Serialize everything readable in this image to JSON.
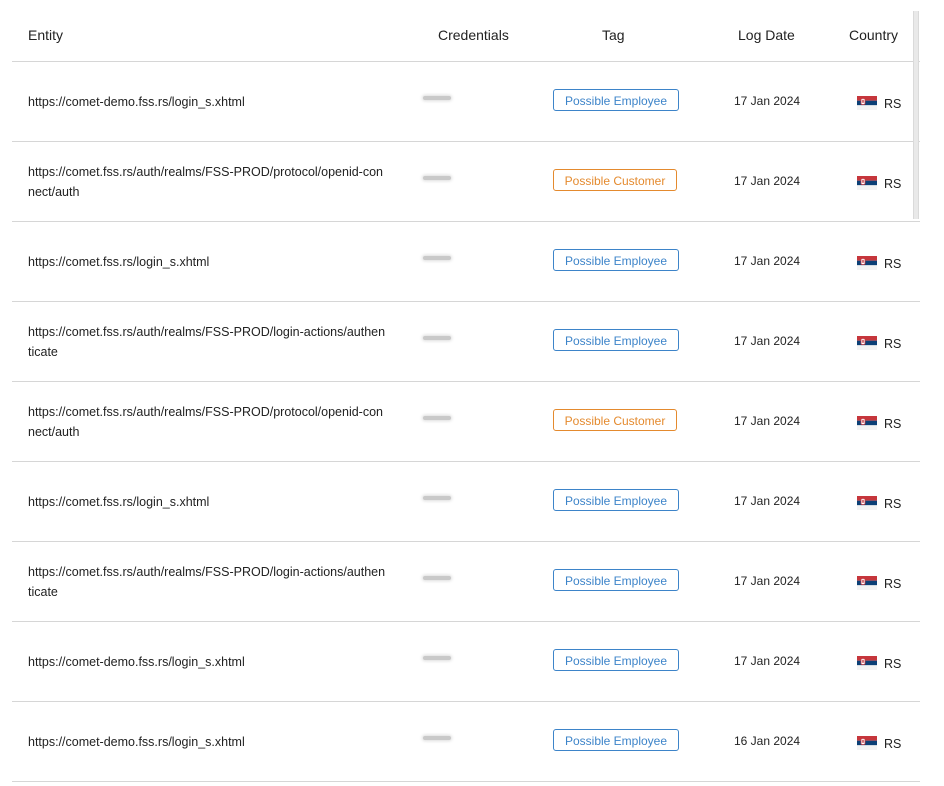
{
  "headers": {
    "entity": "Entity",
    "credentials": "Credentials",
    "tag": "Tag",
    "log_date": "Log Date",
    "country": "Country"
  },
  "tag_colors": {
    "Possible Employee": "#3d84c9",
    "Possible Customer": "#e48a2e"
  },
  "rows": [
    {
      "entity": "https://comet-demo.fss.rs/login_s.xhtml",
      "tag": "Possible Employee",
      "tag_type": "employee",
      "date": "17 Jan 2024",
      "country": "RS",
      "flag_icon": "serbia-flag-icon"
    },
    {
      "entity": "https://comet.fss.rs/auth/realms/FSS-PROD/protocol/openid-connect/auth",
      "tag": "Possible Customer",
      "tag_type": "customer",
      "date": "17 Jan 2024",
      "country": "RS",
      "flag_icon": "serbia-flag-icon"
    },
    {
      "entity": "https://comet.fss.rs/login_s.xhtml",
      "tag": "Possible Employee",
      "tag_type": "employee",
      "date": "17 Jan 2024",
      "country": "RS",
      "flag_icon": "serbia-flag-icon"
    },
    {
      "entity": "https://comet.fss.rs/auth/realms/FSS-PROD/login-actions/authenticate",
      "tag": "Possible Employee",
      "tag_type": "employee",
      "date": "17 Jan 2024",
      "country": "RS",
      "flag_icon": "serbia-flag-icon"
    },
    {
      "entity": "https://comet.fss.rs/auth/realms/FSS-PROD/protocol/openid-connect/auth",
      "tag": "Possible Customer",
      "tag_type": "customer",
      "date": "17 Jan 2024",
      "country": "RS",
      "flag_icon": "serbia-flag-icon"
    },
    {
      "entity": "https://comet.fss.rs/login_s.xhtml",
      "tag": "Possible Employee",
      "tag_type": "employee",
      "date": "17 Jan 2024",
      "country": "RS",
      "flag_icon": "serbia-flag-icon"
    },
    {
      "entity": "https://comet.fss.rs/auth/realms/FSS-PROD/login-actions/authenticate",
      "tag": "Possible Employee",
      "tag_type": "employee",
      "date": "17 Jan 2024",
      "country": "RS",
      "flag_icon": "serbia-flag-icon"
    },
    {
      "entity": "https://comet-demo.fss.rs/login_s.xhtml",
      "tag": "Possible Employee",
      "tag_type": "employee",
      "date": "17 Jan 2024",
      "country": "RS",
      "flag_icon": "serbia-flag-icon"
    },
    {
      "entity": "https://comet-demo.fss.rs/login_s.xhtml",
      "tag": "Possible Employee",
      "tag_type": "employee",
      "date": "16 Jan 2024",
      "country": "RS",
      "flag_icon": "serbia-flag-icon"
    }
  ]
}
